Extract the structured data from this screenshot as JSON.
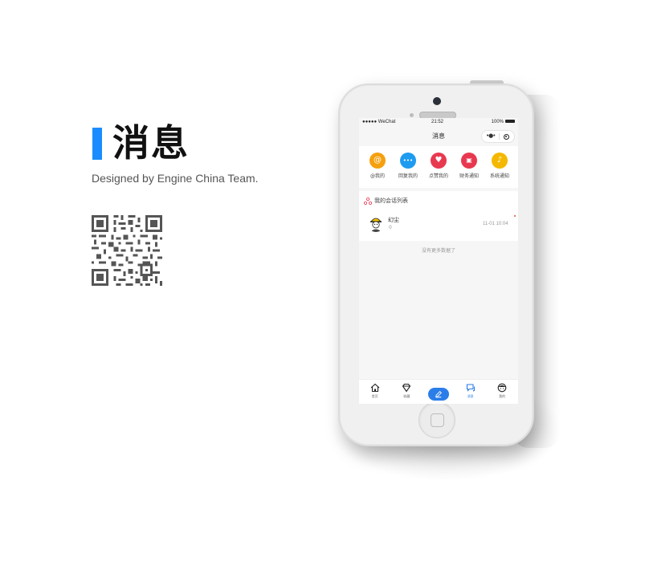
{
  "promo": {
    "title": "消息",
    "subtitle": "Designed by Engine China Team."
  },
  "status_bar": {
    "carrier": "●●●●● WeChat",
    "time": "21:52",
    "battery": "100%"
  },
  "nav": {
    "title": "消息",
    "more_icon": "more-dots-icon",
    "close_icon": "target-circle-icon"
  },
  "quick_actions": [
    {
      "label": "@我的",
      "glyph": "@",
      "color": "#f5a00f",
      "icon": "at-icon"
    },
    {
      "label": "回复我的",
      "glyph": "•••",
      "color": "#1e9bf0",
      "icon": "chat-bubble-icon"
    },
    {
      "label": "点赞我的",
      "glyph": "♥",
      "color": "#e8384f",
      "icon": "heart-icon"
    },
    {
      "label": "财务通知",
      "glyph": "▣",
      "color": "#e8384f",
      "icon": "wallet-icon"
    },
    {
      "label": "系统通知",
      "glyph": "♪",
      "color": "#f5b800",
      "icon": "bell-icon"
    }
  ],
  "conversations": {
    "header": "我的会话列表",
    "items": [
      {
        "name": "幻尘",
        "count": "0",
        "time": "11-01 10:04",
        "avatar": "worker-avatar-icon"
      }
    ]
  },
  "no_more": "没有更多数据了",
  "tabbar": [
    {
      "label": "首页",
      "icon": "home-icon",
      "active": false
    },
    {
      "label": "收藏",
      "icon": "diamond-icon",
      "active": false
    },
    {
      "label": "",
      "icon": "pen-icon",
      "center": true
    },
    {
      "label": "消息",
      "icon": "message-icon",
      "active": true
    },
    {
      "label": "我的",
      "icon": "face-icon",
      "active": false
    }
  ]
}
